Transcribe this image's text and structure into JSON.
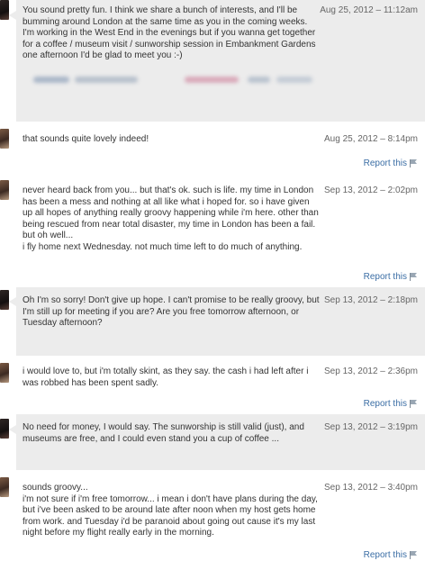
{
  "messages": [
    {
      "body": "You sound pretty fun. I think we share a bunch of interests, and I'll be bumming around London at the same time as you in the coming weeks. I'm working in the West End in the evenings but if you wanna get together for a coffee / museum visit / sunworship session in Embankment Gardens one afternoon I'd be glad to meet you :-)",
      "date": "Aug 25, 2012 – 11:12am"
    },
    {
      "body": "that sounds quite lovely indeed!",
      "date": "Aug 25, 2012 – 8:14pm",
      "report": "Report this"
    },
    {
      "body": "never heard back from you... but that's ok. such is life. my time in London has been a mess and nothing at all like what i hoped for. so i have given up all hopes of anything really groovy happening while i'm here. other than being rescued from near total disaster, my time in London has been a fail.\nbut oh well...\ni fly home next Wednesday. not much time left to do much of anything.",
      "date": "Sep 13, 2012 – 2:02pm",
      "report": "Report this"
    },
    {
      "body": "Oh I'm so sorry! Don't give up hope. I can't promise to be really groovy, but I'm still up for meeting if you are? Are you free tomorrow afternoon, or Tuesday afternoon?",
      "date": "Sep 13, 2012 – 2:18pm"
    },
    {
      "body": "i would love to, but i'm totally skint, as they say. the cash i had left after i was robbed has been spent sadly.",
      "date": "Sep 13, 2012 – 2:36pm",
      "report": "Report this"
    },
    {
      "body": "No need for money, I would say. The sunworship is still valid (just), and museums are free, and I could even stand you a cup of coffee ...",
      "date": "Sep 13, 2012 – 3:19pm"
    },
    {
      "body": "sounds groovy...\ni'm not sure if i'm free tomorrow... i mean i don't have plans during the day, but i've been asked to be around late after noon when my host gets home from work. and Tuesday i'd be paranoid about going out cause it's my last night before my flight really early in the morning.",
      "date": "Sep 13, 2012 – 3:40pm",
      "report": "Report this"
    }
  ],
  "colors": {
    "bubble_grey": "#ececec",
    "link_blue": "#3b6ea5",
    "date_grey": "#666666"
  },
  "icons": {
    "report": "flag-icon"
  }
}
